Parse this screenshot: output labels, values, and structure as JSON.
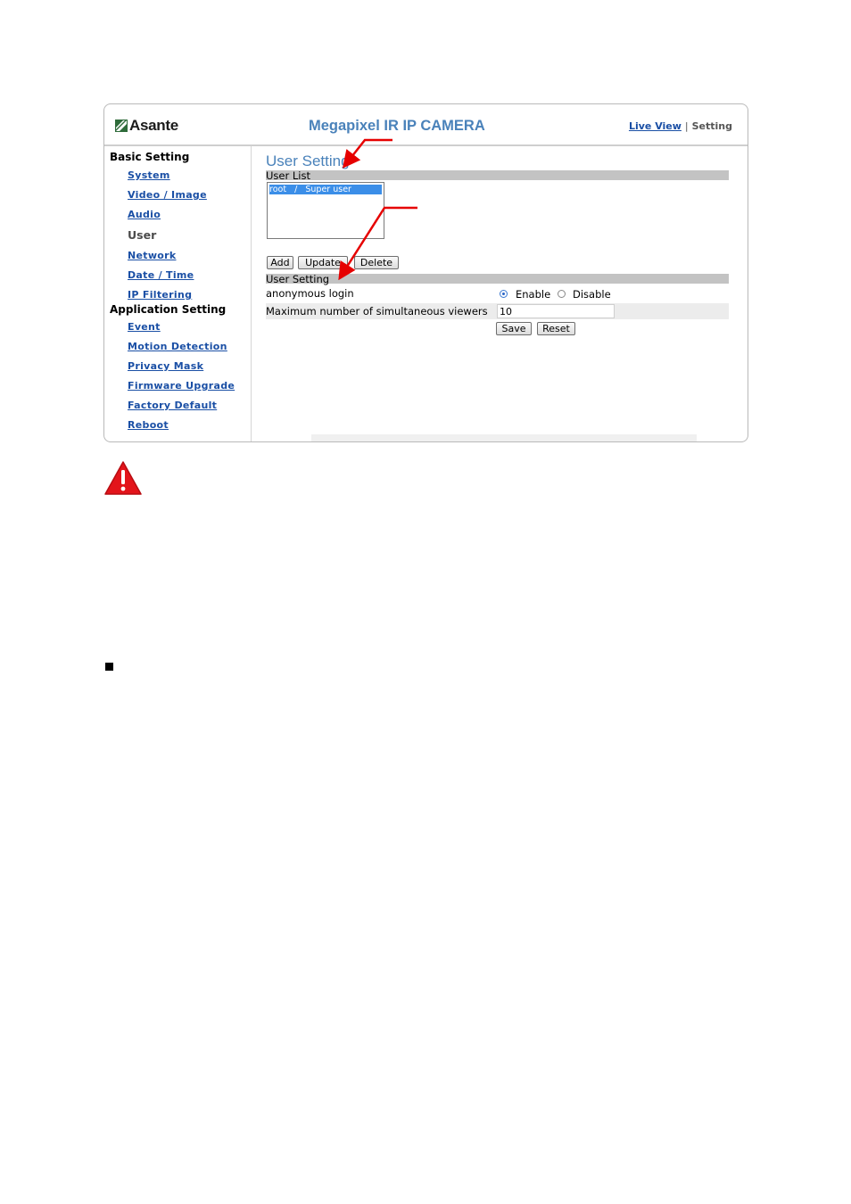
{
  "header": {
    "logo": "Asante",
    "product_title": "Megapixel IR IP CAMERA",
    "live_view": "Live View",
    "separator": "|",
    "setting": "Setting"
  },
  "sidebar": {
    "basic_group": "Basic Setting",
    "basic_items": [
      "System",
      "Video / Image",
      "Audio",
      "User",
      "Network",
      "Date / Time",
      "IP Filtering"
    ],
    "current_item": "User",
    "app_group": "Application Setting",
    "app_items": [
      "Event",
      "Motion Detection",
      "Privacy Mask",
      "Firmware Upgrade",
      "Factory Default",
      "Reboot"
    ]
  },
  "main": {
    "title": "User Setting",
    "user_list_header": "User List",
    "user_list_items": [
      "root   /   Super user"
    ],
    "buttons": {
      "add": "Add",
      "update": "Update",
      "delete": "Delete"
    },
    "user_setting_header": "User Setting",
    "anonymous_login_label": "anonymous login",
    "anonymous_login_options": {
      "enable": "Enable",
      "disable": "Disable",
      "selected": "Enable"
    },
    "max_viewers_label": "Maximum number of simultaneous viewers",
    "max_viewers_value": "10",
    "save": "Save",
    "reset": "Reset"
  },
  "colors": {
    "title_blue": "#4a82ba",
    "link_blue": "#1a4fa5",
    "header_bar": "#c3c3c3",
    "selection": "#3b8ee8",
    "annotation_arrow": "#e60000",
    "warning_red": "#e3141b"
  },
  "icons": {
    "logo": "asante-logo-icon",
    "warning": "warning-triangle-icon",
    "bullet": "square-bullet-icon"
  }
}
